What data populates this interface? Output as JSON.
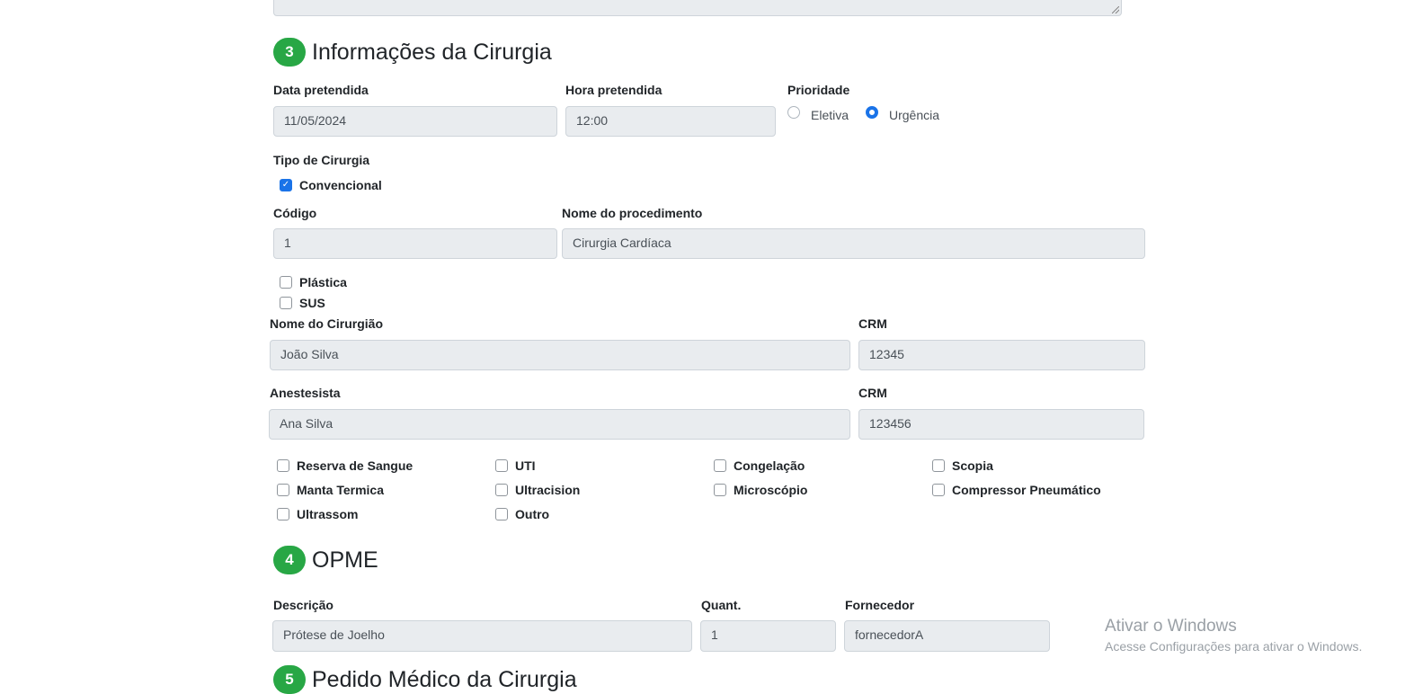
{
  "section3": {
    "number": "3",
    "title": "Informações da Cirurgia",
    "data_pretendida": {
      "label": "Data pretendida",
      "value": "11/05/2024"
    },
    "hora_pretendida": {
      "label": "Hora pretendida",
      "value": "12:00"
    },
    "prioridade": {
      "label": "Prioridade",
      "options": [
        {
          "label": "Eletiva",
          "selected": false
        },
        {
          "label": "Urgência",
          "selected": true
        }
      ]
    },
    "tipo_cirurgia": {
      "label": "Tipo de Cirurgia",
      "convencional": {
        "label": "Convencional",
        "checked": true
      },
      "plastica": {
        "label": "Plástica",
        "checked": false
      },
      "sus": {
        "label": "SUS",
        "checked": false
      }
    },
    "codigo": {
      "label": "Código",
      "value": "1"
    },
    "nome_procedimento": {
      "label": "Nome do procedimento",
      "value": "Cirurgia Cardíaca"
    },
    "cirurgiao": {
      "label": "Nome do Cirurgião",
      "value": "João Silva"
    },
    "crm_cirurgiao": {
      "label": "CRM",
      "value": "12345"
    },
    "anestesista": {
      "label": "Anestesista",
      "value": "Ana Silva"
    },
    "crm_anestesista": {
      "label": "CRM",
      "value": "123456"
    },
    "recursos": [
      {
        "label": "Reserva de Sangue",
        "checked": false
      },
      {
        "label": "UTI",
        "checked": false
      },
      {
        "label": "Congelação",
        "checked": false
      },
      {
        "label": "Scopia",
        "checked": false
      },
      {
        "label": "Manta Termica",
        "checked": false
      },
      {
        "label": "Ultracision",
        "checked": false
      },
      {
        "label": "Microscópio",
        "checked": false
      },
      {
        "label": "Compressor Pneumático",
        "checked": false
      },
      {
        "label": "Ultrassom",
        "checked": false
      },
      {
        "label": "Outro",
        "checked": false
      }
    ]
  },
  "section4": {
    "number": "4",
    "title": "OPME",
    "descricao": {
      "label": "Descrição",
      "value": "Prótese de Joelho"
    },
    "quant": {
      "label": "Quant.",
      "value": "1"
    },
    "fornecedor": {
      "label": "Fornecedor",
      "value": "fornecedorA"
    }
  },
  "section5": {
    "number": "5",
    "title": "Pedido Médico da Cirurgia"
  },
  "watermark": {
    "title": "Ativar o Windows",
    "subtitle": "Acesse Configurações para ativar o Windows."
  },
  "colors": {
    "badge": "#28a745",
    "accent": "#1a73e8",
    "input_bg": "#e9ecef"
  }
}
